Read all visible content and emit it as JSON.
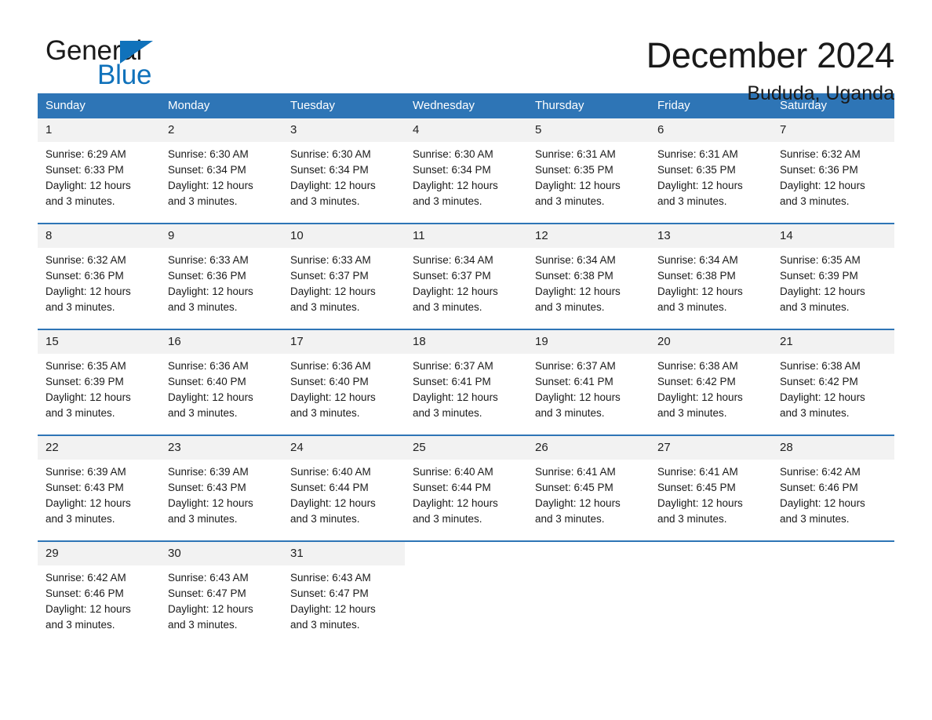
{
  "logo": {
    "word_primary": "General",
    "word_secondary": "Blue",
    "triangle_color": "#1072bb",
    "icon": "triangle-icon"
  },
  "header": {
    "month_title": "December 2024",
    "location": "Bududa, Uganda"
  },
  "colors": {
    "header_blue": "#2e75b6",
    "row_divider_blue": "#2e75b6",
    "date_band_gray": "#f2f2f2",
    "logo_blue": "#1072bb"
  },
  "calendar": {
    "weekday_headers": [
      "Sunday",
      "Monday",
      "Tuesday",
      "Wednesday",
      "Thursday",
      "Friday",
      "Saturday"
    ],
    "labels": {
      "sunrise": "Sunrise:",
      "sunset": "Sunset:",
      "daylight": "Daylight:"
    },
    "weeks": [
      [
        {
          "day": "1",
          "sunrise": "Sunrise: 6:29 AM",
          "sunset": "Sunset: 6:33 PM",
          "daylight_1": "Daylight: 12 hours",
          "daylight_2": "and 3 minutes."
        },
        {
          "day": "2",
          "sunrise": "Sunrise: 6:30 AM",
          "sunset": "Sunset: 6:34 PM",
          "daylight_1": "Daylight: 12 hours",
          "daylight_2": "and 3 minutes."
        },
        {
          "day": "3",
          "sunrise": "Sunrise: 6:30 AM",
          "sunset": "Sunset: 6:34 PM",
          "daylight_1": "Daylight: 12 hours",
          "daylight_2": "and 3 minutes."
        },
        {
          "day": "4",
          "sunrise": "Sunrise: 6:30 AM",
          "sunset": "Sunset: 6:34 PM",
          "daylight_1": "Daylight: 12 hours",
          "daylight_2": "and 3 minutes."
        },
        {
          "day": "5",
          "sunrise": "Sunrise: 6:31 AM",
          "sunset": "Sunset: 6:35 PM",
          "daylight_1": "Daylight: 12 hours",
          "daylight_2": "and 3 minutes."
        },
        {
          "day": "6",
          "sunrise": "Sunrise: 6:31 AM",
          "sunset": "Sunset: 6:35 PM",
          "daylight_1": "Daylight: 12 hours",
          "daylight_2": "and 3 minutes."
        },
        {
          "day": "7",
          "sunrise": "Sunrise: 6:32 AM",
          "sunset": "Sunset: 6:36 PM",
          "daylight_1": "Daylight: 12 hours",
          "daylight_2": "and 3 minutes."
        }
      ],
      [
        {
          "day": "8",
          "sunrise": "Sunrise: 6:32 AM",
          "sunset": "Sunset: 6:36 PM",
          "daylight_1": "Daylight: 12 hours",
          "daylight_2": "and 3 minutes."
        },
        {
          "day": "9",
          "sunrise": "Sunrise: 6:33 AM",
          "sunset": "Sunset: 6:36 PM",
          "daylight_1": "Daylight: 12 hours",
          "daylight_2": "and 3 minutes."
        },
        {
          "day": "10",
          "sunrise": "Sunrise: 6:33 AM",
          "sunset": "Sunset: 6:37 PM",
          "daylight_1": "Daylight: 12 hours",
          "daylight_2": "and 3 minutes."
        },
        {
          "day": "11",
          "sunrise": "Sunrise: 6:34 AM",
          "sunset": "Sunset: 6:37 PM",
          "daylight_1": "Daylight: 12 hours",
          "daylight_2": "and 3 minutes."
        },
        {
          "day": "12",
          "sunrise": "Sunrise: 6:34 AM",
          "sunset": "Sunset: 6:38 PM",
          "daylight_1": "Daylight: 12 hours",
          "daylight_2": "and 3 minutes."
        },
        {
          "day": "13",
          "sunrise": "Sunrise: 6:34 AM",
          "sunset": "Sunset: 6:38 PM",
          "daylight_1": "Daylight: 12 hours",
          "daylight_2": "and 3 minutes."
        },
        {
          "day": "14",
          "sunrise": "Sunrise: 6:35 AM",
          "sunset": "Sunset: 6:39 PM",
          "daylight_1": "Daylight: 12 hours",
          "daylight_2": "and 3 minutes."
        }
      ],
      [
        {
          "day": "15",
          "sunrise": "Sunrise: 6:35 AM",
          "sunset": "Sunset: 6:39 PM",
          "daylight_1": "Daylight: 12 hours",
          "daylight_2": "and 3 minutes."
        },
        {
          "day": "16",
          "sunrise": "Sunrise: 6:36 AM",
          "sunset": "Sunset: 6:40 PM",
          "daylight_1": "Daylight: 12 hours",
          "daylight_2": "and 3 minutes."
        },
        {
          "day": "17",
          "sunrise": "Sunrise: 6:36 AM",
          "sunset": "Sunset: 6:40 PM",
          "daylight_1": "Daylight: 12 hours",
          "daylight_2": "and 3 minutes."
        },
        {
          "day": "18",
          "sunrise": "Sunrise: 6:37 AM",
          "sunset": "Sunset: 6:41 PM",
          "daylight_1": "Daylight: 12 hours",
          "daylight_2": "and 3 minutes."
        },
        {
          "day": "19",
          "sunrise": "Sunrise: 6:37 AM",
          "sunset": "Sunset: 6:41 PM",
          "daylight_1": "Daylight: 12 hours",
          "daylight_2": "and 3 minutes."
        },
        {
          "day": "20",
          "sunrise": "Sunrise: 6:38 AM",
          "sunset": "Sunset: 6:42 PM",
          "daylight_1": "Daylight: 12 hours",
          "daylight_2": "and 3 minutes."
        },
        {
          "day": "21",
          "sunrise": "Sunrise: 6:38 AM",
          "sunset": "Sunset: 6:42 PM",
          "daylight_1": "Daylight: 12 hours",
          "daylight_2": "and 3 minutes."
        }
      ],
      [
        {
          "day": "22",
          "sunrise": "Sunrise: 6:39 AM",
          "sunset": "Sunset: 6:43 PM",
          "daylight_1": "Daylight: 12 hours",
          "daylight_2": "and 3 minutes."
        },
        {
          "day": "23",
          "sunrise": "Sunrise: 6:39 AM",
          "sunset": "Sunset: 6:43 PM",
          "daylight_1": "Daylight: 12 hours",
          "daylight_2": "and 3 minutes."
        },
        {
          "day": "24",
          "sunrise": "Sunrise: 6:40 AM",
          "sunset": "Sunset: 6:44 PM",
          "daylight_1": "Daylight: 12 hours",
          "daylight_2": "and 3 minutes."
        },
        {
          "day": "25",
          "sunrise": "Sunrise: 6:40 AM",
          "sunset": "Sunset: 6:44 PM",
          "daylight_1": "Daylight: 12 hours",
          "daylight_2": "and 3 minutes."
        },
        {
          "day": "26",
          "sunrise": "Sunrise: 6:41 AM",
          "sunset": "Sunset: 6:45 PM",
          "daylight_1": "Daylight: 12 hours",
          "daylight_2": "and 3 minutes."
        },
        {
          "day": "27",
          "sunrise": "Sunrise: 6:41 AM",
          "sunset": "Sunset: 6:45 PM",
          "daylight_1": "Daylight: 12 hours",
          "daylight_2": "and 3 minutes."
        },
        {
          "day": "28",
          "sunrise": "Sunrise: 6:42 AM",
          "sunset": "Sunset: 6:46 PM",
          "daylight_1": "Daylight: 12 hours",
          "daylight_2": "and 3 minutes."
        }
      ],
      [
        {
          "day": "29",
          "sunrise": "Sunrise: 6:42 AM",
          "sunset": "Sunset: 6:46 PM",
          "daylight_1": "Daylight: 12 hours",
          "daylight_2": "and 3 minutes."
        },
        {
          "day": "30",
          "sunrise": "Sunrise: 6:43 AM",
          "sunset": "Sunset: 6:47 PM",
          "daylight_1": "Daylight: 12 hours",
          "daylight_2": "and 3 minutes."
        },
        {
          "day": "31",
          "sunrise": "Sunrise: 6:43 AM",
          "sunset": "Sunset: 6:47 PM",
          "daylight_1": "Daylight: 12 hours",
          "daylight_2": "and 3 minutes."
        },
        {
          "day": "",
          "sunrise": "",
          "sunset": "",
          "daylight_1": "",
          "daylight_2": ""
        },
        {
          "day": "",
          "sunrise": "",
          "sunset": "",
          "daylight_1": "",
          "daylight_2": ""
        },
        {
          "day": "",
          "sunrise": "",
          "sunset": "",
          "daylight_1": "",
          "daylight_2": ""
        },
        {
          "day": "",
          "sunrise": "",
          "sunset": "",
          "daylight_1": "",
          "daylight_2": ""
        }
      ]
    ]
  }
}
